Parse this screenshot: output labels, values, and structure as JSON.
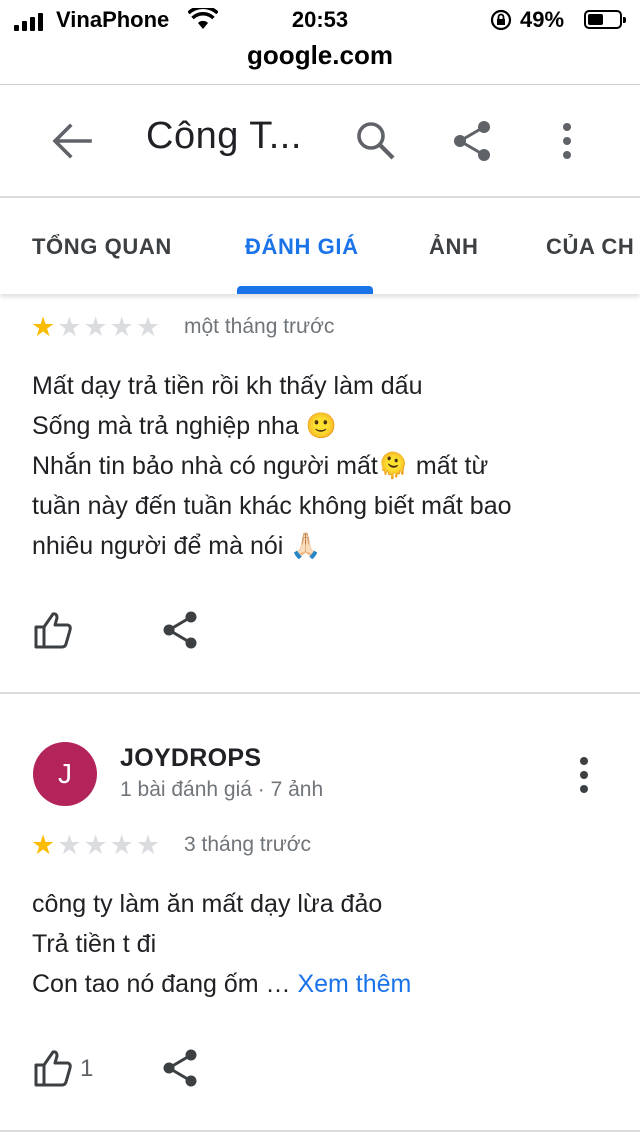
{
  "status_bar": {
    "carrier": "VinaPhone",
    "time": "20:53",
    "battery": "49%",
    "battery_level": 0.49
  },
  "url": "google.com",
  "header": {
    "title": "Công T..."
  },
  "tabs": [
    {
      "label": "TỔNG QUAN",
      "active": false
    },
    {
      "label": "ĐÁNH GIÁ",
      "active": true
    },
    {
      "label": "ẢNH",
      "active": false
    },
    {
      "label": "CỦA CH",
      "active": false
    }
  ],
  "reviews": [
    {
      "rating": 1,
      "date": "một tháng trước",
      "lines": [
        "Mất dạy trả tiền rồi kh thấy làm dấu",
        "Sống mà trả nghiệp nha 🙂",
        "Nhắn tin bảo nhà có người mất🫠 mất từ",
        "tuần này đến tuần khác không biết mất bao",
        "nhiêu người để mà nói 🙏🏻"
      ]
    },
    {
      "avatar_letter": "J",
      "avatar_color": "#b3245a",
      "author": "JOYDROPS",
      "author_meta": "1 bài đánh giá · 7 ảnh",
      "rating": 1,
      "date": "3 tháng trước",
      "lines": [
        "công ty làm ăn mất dạy lừa đảo",
        "Trả tiền t đi",
        "Con tao nó đang ốm …"
      ],
      "more_label": "Xem thêm",
      "likes": "1"
    }
  ],
  "colors": {
    "accent": "#1a73e8",
    "star": "#fbbc04"
  }
}
